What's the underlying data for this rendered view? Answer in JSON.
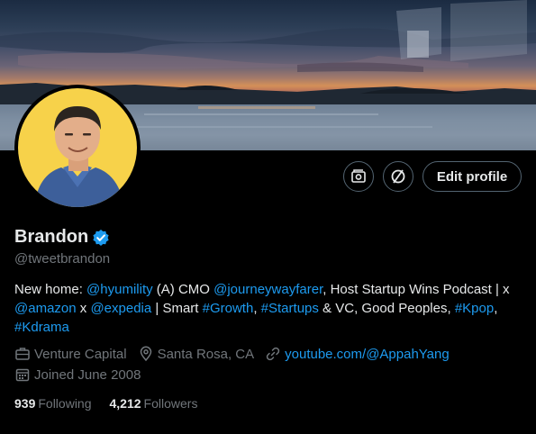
{
  "profile": {
    "name": "Brandon",
    "handle": "@tweetbrandon",
    "verified_color": "#1d9bf0",
    "buttons": {
      "media_icon": "media-studio-icon",
      "normal_icon": "circle-slash-icon",
      "edit_label": "Edit profile"
    },
    "bio": [
      {
        "type": "text",
        "value": "New home: "
      },
      {
        "type": "link",
        "value": "@hyumility"
      },
      {
        "type": "text",
        "value": " (A) CMO "
      },
      {
        "type": "link",
        "value": "@journeywayfarer"
      },
      {
        "type": "text",
        "value": ", Host Startup Wins Podcast | x "
      },
      {
        "type": "link",
        "value": "@amazon"
      },
      {
        "type": "text",
        "value": " x "
      },
      {
        "type": "link",
        "value": "@expedia"
      },
      {
        "type": "text",
        "value": " | Smart "
      },
      {
        "type": "link",
        "value": "#Growth"
      },
      {
        "type": "text",
        "value": ", "
      },
      {
        "type": "link",
        "value": "#Startups"
      },
      {
        "type": "text",
        "value": " & VC, Good Peoples, "
      },
      {
        "type": "link",
        "value": "#Kpop"
      },
      {
        "type": "text",
        "value": ", "
      },
      {
        "type": "link",
        "value": "#Kdrama"
      }
    ],
    "meta": {
      "category": "Venture Capital",
      "location": "Santa Rosa, CA",
      "website": "youtube.com/@AppahYang",
      "joined": "Joined June 2008"
    },
    "stats": {
      "following_count": "939",
      "following_label": "Following",
      "followers_count": "4,212",
      "followers_label": "Followers"
    }
  },
  "colors": {
    "background": "#000000",
    "text_primary": "#e7e9ea",
    "text_secondary": "#71767b",
    "accent": "#1d9bf0",
    "border": "#536471",
    "avatar_bg": "#f7d24a"
  }
}
